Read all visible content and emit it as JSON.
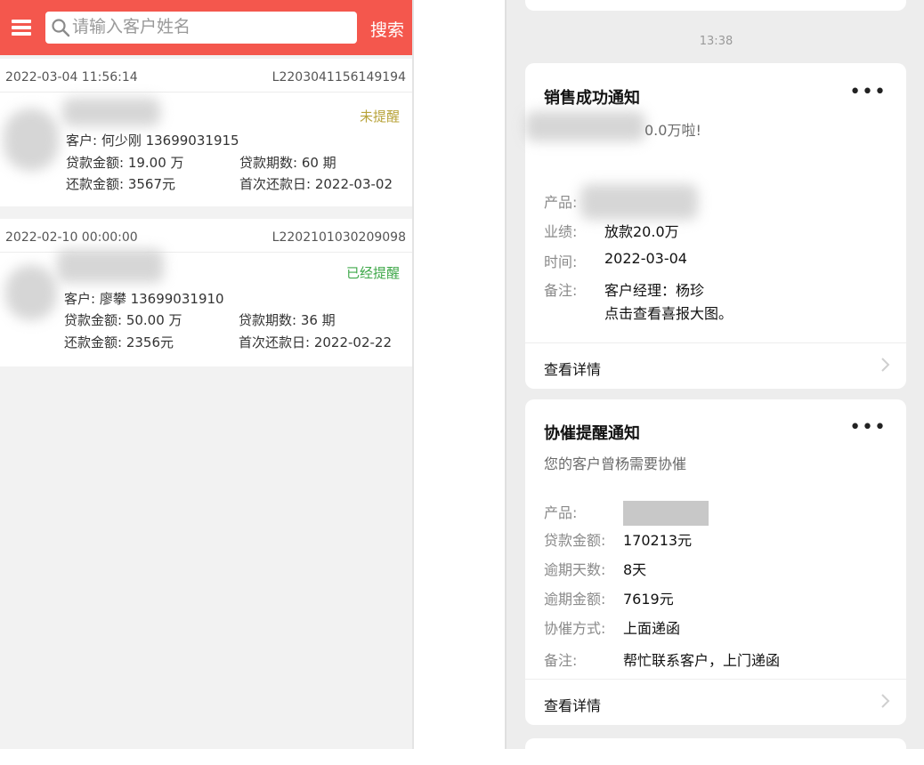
{
  "left": {
    "search": {
      "placeholder": "请输入客户姓名",
      "button": "搜索"
    },
    "records": [
      {
        "datetime": "2022-03-04 11:56:14",
        "loan_no": "L2203041156149194",
        "status": "未提醒",
        "status_color": "#b8a33a",
        "customer": "客户: 何少刚  13699031915",
        "amount": "贷款金额: 19.00 万",
        "term": "贷款期数: 60 期",
        "repay": "还款金额: 3567元",
        "first_date": "首次还款日: 2022-03-02"
      },
      {
        "datetime": "2022-02-10 00:00:00",
        "loan_no": "L2202101030209098",
        "status": "已经提醒",
        "status_color": "#3fa84a",
        "customer": "客户: 廖攀  13699031910",
        "amount": "贷款金额: 50.00 万",
        "term": "贷款期数: 36 期",
        "repay": "还款金额: 2356元",
        "first_date": "首次还款日: 2022-02-22"
      }
    ]
  },
  "right": {
    "timestamp": "13:38",
    "sale_card": {
      "title": "销售成功通知",
      "subtitle_partial": "0.0万啦!",
      "rows": [
        {
          "key": "产品:",
          "value": ""
        },
        {
          "key": "业绩:",
          "value": "放款20.0万"
        },
        {
          "key": "时间:",
          "value": "2022-03-04"
        },
        {
          "key": "备注:",
          "value": "客户经理：杨珍"
        }
      ],
      "note_line2": "点击查看喜报大图。",
      "footer": "查看详情"
    },
    "collect_card": {
      "title": "协催提醒通知",
      "subtitle": "您的客户曾杨需要协催",
      "rows": [
        {
          "key": "产品:",
          "value": ""
        },
        {
          "key": "贷款金额:",
          "value": "170213元"
        },
        {
          "key": "逾期天数:",
          "value": "8天"
        },
        {
          "key": "逾期金额:",
          "value": "7619元"
        },
        {
          "key": "协催方式:",
          "value": "上面递函"
        },
        {
          "key": "备注:",
          "value": "帮忙联系客户，上门递函"
        }
      ],
      "footer": "查看详情"
    }
  },
  "icons": {
    "menu": "menu-icon",
    "search": "search-icon",
    "more": "more-dots-icon",
    "chevron": "chevron-right-icon"
  },
  "colors": {
    "brand": "#f4574d",
    "pending": "#b8a33a",
    "done": "#3fa84a"
  }
}
